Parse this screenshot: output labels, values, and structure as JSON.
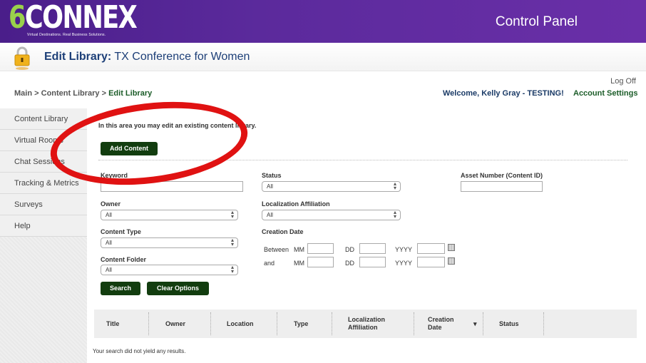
{
  "header": {
    "logo_digit": "6",
    "logo_letters": "CONNEX",
    "logo_tagline": "Virtual Destinations. Real Business Solutions.",
    "control_panel": "Control Panel",
    "title_prefix": "Edit Library:",
    "title_name": "TX Conference for Women"
  },
  "topnav": {
    "logoff": "Log Off",
    "breadcrumb": [
      "Main",
      ">",
      "Content Library",
      ">",
      "Edit Library"
    ],
    "welcome": "Welcome, Kelly Gray - TESTING!",
    "account_settings": "Account Settings"
  },
  "sidebar": {
    "items": [
      {
        "label": "Content Library"
      },
      {
        "label": "Virtual Rooms"
      },
      {
        "label": "Chat Sessions"
      },
      {
        "label": "Tracking & Metrics"
      },
      {
        "label": "Surveys"
      },
      {
        "label": "Help"
      }
    ]
  },
  "main": {
    "intro": "In this area you may edit an existing content library.",
    "add_button": "Add Content",
    "filters": {
      "keyword_label": "Keyword",
      "status_label": "Status",
      "status_value": "All",
      "asset_label": "Asset Number (Content ID)",
      "owner_label": "Owner",
      "owner_value": "All",
      "localization_label": "Localization Affiliation",
      "localization_value": "All",
      "content_type_label": "Content Type",
      "content_type_value": "All",
      "creation_date_label": "Creation Date",
      "between_label": "Between",
      "and_label": "and",
      "mm": "MM",
      "dd": "DD",
      "yyyy": "YYYY",
      "content_folder_label": "Content Folder",
      "content_folder_value": "All"
    },
    "search_button": "Search",
    "clear_button": "Clear Options",
    "table": {
      "columns": [
        "Title",
        "Owner",
        "Location",
        "Type",
        "Localization Affiliation",
        "Creation Date",
        "Status"
      ],
      "sort_indicator": "▾",
      "empty_message": "Your search did not yield any results."
    }
  },
  "colors": {
    "header_purple": "#5b2a9c",
    "logo_green": "#9ad14b",
    "button_green": "#123d0f",
    "annotation_red": "#e01212"
  },
  "icons": [
    "lock-icon",
    "calendar-icon",
    "select-arrow-icon",
    "sort-down-icon"
  ]
}
